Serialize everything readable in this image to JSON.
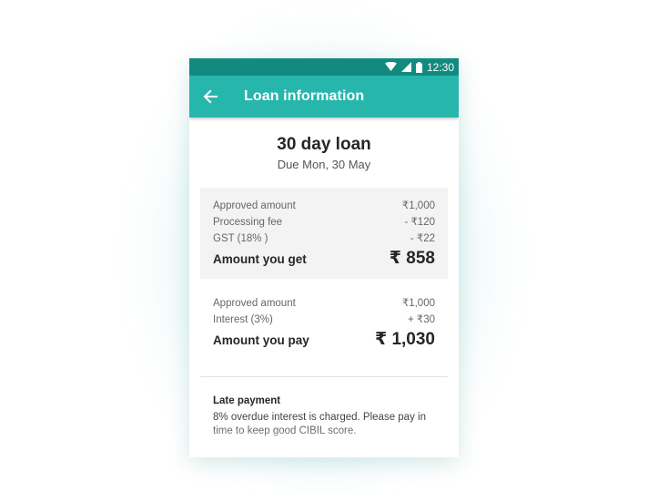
{
  "status_bar": {
    "time": "12:30"
  },
  "app_bar": {
    "title": "Loan information"
  },
  "loan": {
    "title": "30 day loan",
    "due": "Due Mon, 30 May"
  },
  "receive_breakdown": {
    "rows": [
      {
        "label": "Approved amount",
        "value": "₹1,000"
      },
      {
        "label": "Processing fee",
        "value": "- ₹120"
      },
      {
        "label": "GST (18% )",
        "value": "- ₹22"
      }
    ],
    "total_label": "Amount you get",
    "total_value": "₹ 858"
  },
  "pay_breakdown": {
    "rows": [
      {
        "label": "Approved amount",
        "value": "₹1,000"
      },
      {
        "label": "Interest (3%)",
        "value": "+ ₹30"
      }
    ],
    "total_label": "Amount you pay",
    "total_value": "₹ 1,030"
  },
  "late_payment": {
    "title": "Late payment",
    "text": "8% overdue interest is charged. Please pay in time to keep good CIBIL score."
  },
  "colors": {
    "status_bar": "#138a80",
    "app_bar": "#26b6ac",
    "panel": "#f3f3f3"
  }
}
